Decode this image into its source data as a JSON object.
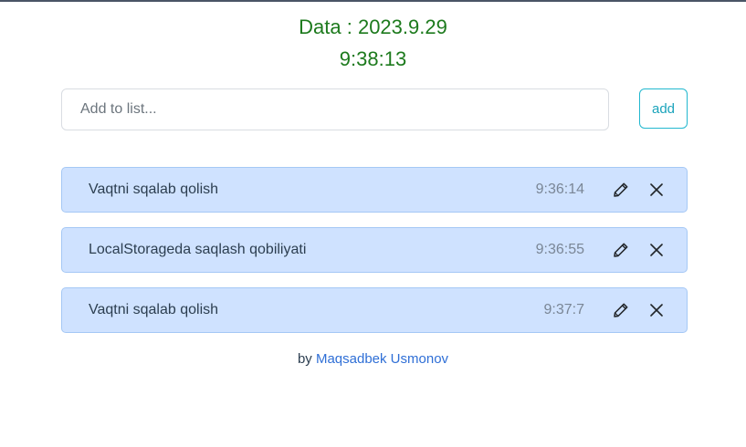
{
  "header": {
    "date_text": "Data : 2023.9.29",
    "time_text": "9:38:13"
  },
  "input": {
    "placeholder": "Add to list...",
    "value": ""
  },
  "add_button": {
    "label": "add"
  },
  "todos": [
    {
      "text": "Vaqtni sqalab qolish",
      "time": "9:36:14"
    },
    {
      "text": "LocalStorageda saqlash qobiliyati",
      "time": "9:36:55"
    },
    {
      "text": "Vaqtni sqalab qolish",
      "time": "9:37:7"
    }
  ],
  "footer": {
    "prefix": "by",
    "author": "Maqsadbek Usmonov"
  },
  "colors": {
    "header_green": "#1d7a1d",
    "item_background": "#cfe2ff",
    "add_button_accent": "#22b8cf",
    "author_link": "#2f6fd6"
  },
  "icons": {
    "edit": "pencil-icon",
    "delete": "close-icon"
  }
}
